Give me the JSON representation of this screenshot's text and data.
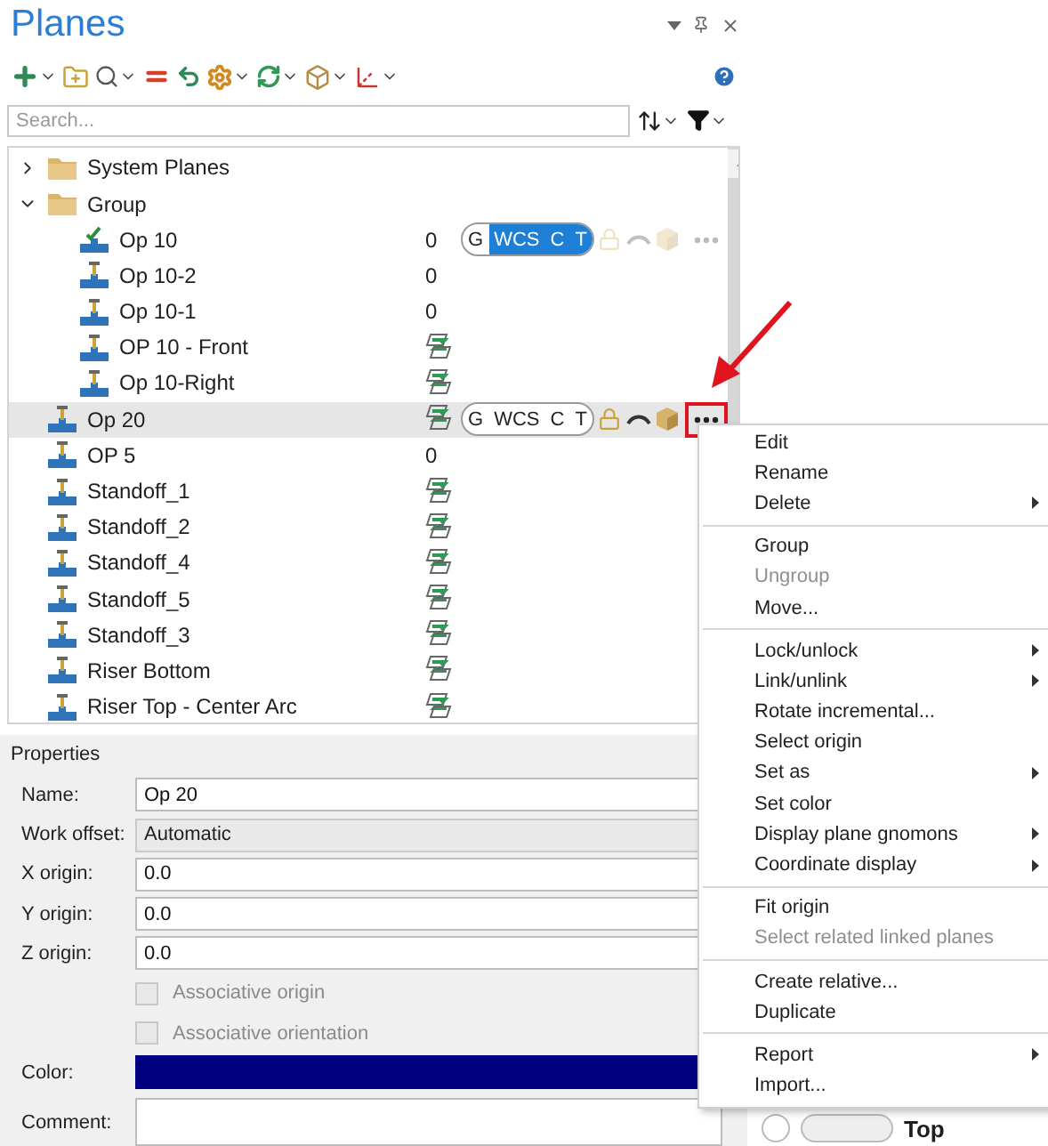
{
  "panel": {
    "title": "Planes"
  },
  "search": {
    "placeholder": "Search..."
  },
  "tree": [
    {
      "name": "System Planes",
      "kind": "folder",
      "expanded": false,
      "selected": false
    },
    {
      "name": "Group",
      "kind": "folder",
      "expanded": true,
      "selected": false,
      "children": [
        {
          "name": "Op 10",
          "kind": "checked-plane",
          "value": "0",
          "linked": false,
          "selected": false,
          "controls": {
            "dimmed": true,
            "more_marked": false,
            "segments": [
              {
                "label": "G",
                "on": false
              },
              {
                "label": "WCS",
                "on": true
              },
              {
                "label": "C",
                "on": true
              },
              {
                "label": "T",
                "on": true
              }
            ]
          }
        },
        {
          "name": "Op 10-2",
          "kind": "plane",
          "value": "0",
          "linked": false,
          "selected": false
        },
        {
          "name": "Op 10-1",
          "kind": "plane",
          "value": "0",
          "linked": false,
          "selected": false
        },
        {
          "name": "OP 10 - Front",
          "kind": "plane",
          "linked": true,
          "selected": false
        },
        {
          "name": "Op 10-Right",
          "kind": "plane",
          "linked": true,
          "selected": false
        }
      ]
    },
    {
      "name": "Op 20",
      "kind": "plane",
      "linked": true,
      "selected": true,
      "controls": {
        "dimmed": false,
        "more_marked": true,
        "segments": [
          {
            "label": "G",
            "on": false
          },
          {
            "label": "WCS",
            "on": false
          },
          {
            "label": "C",
            "on": false
          },
          {
            "label": "T",
            "on": false
          }
        ]
      }
    },
    {
      "name": "OP 5",
      "kind": "plane",
      "value": "0",
      "linked": false,
      "selected": false
    },
    {
      "name": "Standoff_1",
      "kind": "plane",
      "linked": true,
      "selected": false
    },
    {
      "name": "Standoff_2",
      "kind": "plane",
      "linked": true,
      "selected": false
    },
    {
      "name": "Standoff_4",
      "kind": "plane",
      "linked": true,
      "selected": false
    },
    {
      "name": "Standoff_5",
      "kind": "plane",
      "linked": true,
      "selected": false
    },
    {
      "name": "Standoff_3",
      "kind": "plane",
      "linked": true,
      "selected": false
    },
    {
      "name": "Riser Bottom",
      "kind": "plane",
      "linked": true,
      "selected": false
    },
    {
      "name": "Riser Top - Center Arc",
      "kind": "plane",
      "linked": true,
      "selected": false
    }
  ],
  "properties": {
    "title": "Properties",
    "fields": [
      {
        "kind": "text",
        "label": "Name:",
        "value": "Op 20"
      },
      {
        "kind": "select",
        "label": "Work offset:",
        "value": "Automatic"
      },
      {
        "kind": "text",
        "label": "X origin:",
        "value": "0.0"
      },
      {
        "kind": "text",
        "label": "Y origin:",
        "value": "0.0"
      },
      {
        "kind": "text",
        "label": "Z origin:",
        "value": "0.0"
      },
      {
        "kind": "checkbox",
        "label": "Associative origin",
        "checked": false,
        "disabled": true
      },
      {
        "kind": "checkbox",
        "label": "Associative orientation",
        "checked": false,
        "disabled": true
      },
      {
        "kind": "color",
        "label": "Color:",
        "color": "#000080"
      },
      {
        "kind": "textarea",
        "label": "Comment:"
      }
    ]
  },
  "view_label": "Top",
  "context_menu": {
    "groups": [
      [
        {
          "label": "Edit",
          "disabled": false,
          "submenu": false
        },
        {
          "label": "Rename",
          "disabled": false,
          "submenu": false
        },
        {
          "label": "Delete",
          "disabled": false,
          "submenu": true
        }
      ],
      [
        {
          "label": "Group",
          "disabled": false,
          "submenu": false
        },
        {
          "label": "Ungroup",
          "disabled": true,
          "submenu": false
        },
        {
          "label": "Move...",
          "disabled": false,
          "submenu": false
        }
      ],
      [
        {
          "label": "Lock/unlock",
          "disabled": false,
          "submenu": true
        },
        {
          "label": "Link/unlink",
          "disabled": false,
          "submenu": true
        },
        {
          "label": "Rotate incremental...",
          "disabled": false,
          "submenu": false
        },
        {
          "label": "Select origin",
          "disabled": false,
          "submenu": false
        },
        {
          "label": "Set as",
          "disabled": false,
          "submenu": true
        },
        {
          "label": "Set color",
          "disabled": false,
          "submenu": false
        },
        {
          "label": "Display plane gnomons",
          "disabled": false,
          "submenu": true
        },
        {
          "label": "Coordinate display",
          "disabled": false,
          "submenu": true
        }
      ],
      [
        {
          "label": "Fit origin",
          "disabled": false,
          "submenu": false
        },
        {
          "label": "Select related linked planes",
          "disabled": true,
          "submenu": false
        }
      ],
      [
        {
          "label": "Create relative...",
          "disabled": false,
          "submenu": false
        },
        {
          "label": "Duplicate",
          "disabled": false,
          "submenu": false
        }
      ],
      [
        {
          "label": "Report",
          "disabled": false,
          "submenu": true
        },
        {
          "label": "Import...",
          "disabled": false,
          "submenu": false
        }
      ]
    ]
  }
}
